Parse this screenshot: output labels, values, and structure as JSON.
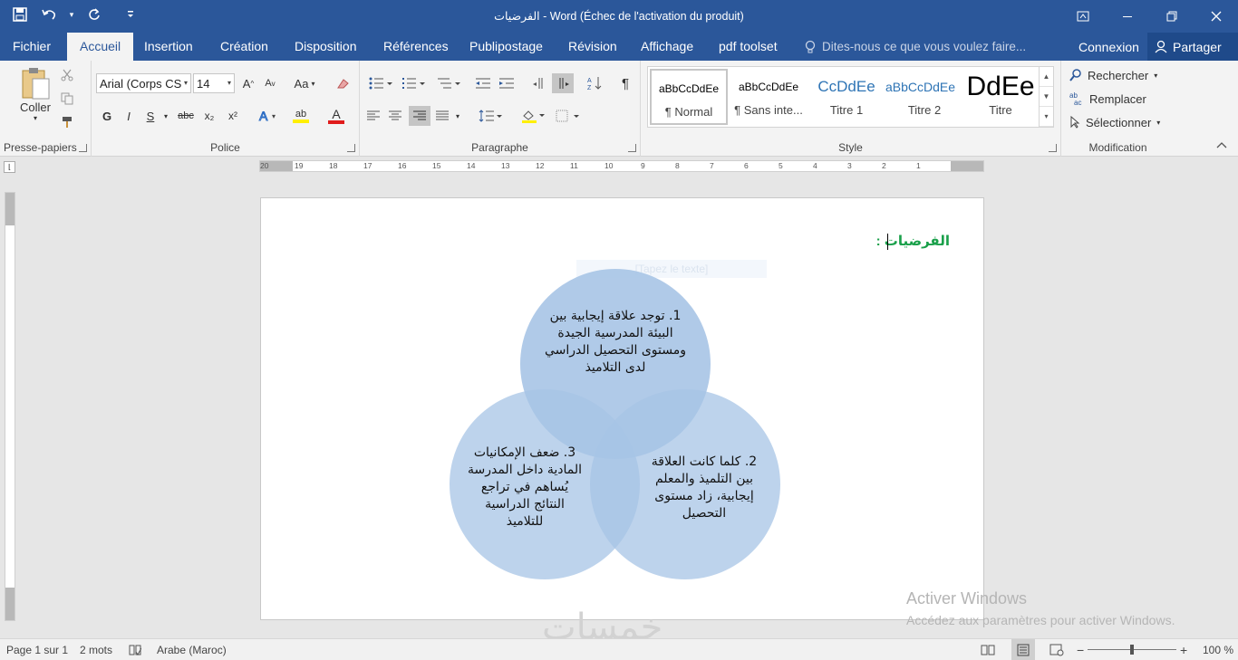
{
  "window": {
    "title": "الفرضيات - Word (Échec de l'activation du produit)"
  },
  "quick_access": {
    "save_icon": "save-icon",
    "undo_icon": "undo-icon",
    "redo_icon": "redo-icon",
    "customize_icon": "customize-icon"
  },
  "menu": {
    "tabs": [
      "Fichier",
      "Accueil",
      "Insertion",
      "Création",
      "Disposition",
      "Références",
      "Publipostage",
      "Révision",
      "Affichage",
      "pdf toolset"
    ],
    "active_tab": "Accueil",
    "tell_me_placeholder": "Dites-nous ce que vous voulez faire...",
    "connexion": "Connexion",
    "partager": "Partager"
  },
  "ribbon": {
    "clipboard": {
      "paste_label": "Coller",
      "group_label": "Presse-papiers"
    },
    "font": {
      "font_name": "Arial (Corps CS",
      "font_size": "14",
      "group_label": "Police",
      "bold": "G",
      "italic": "I",
      "underline": "S",
      "strike": "abc",
      "subscript": "x₂",
      "superscript": "x²",
      "grow": "A",
      "shrink": "A",
      "case": "Aa",
      "highlight": "ab",
      "fontcolor": "A"
    },
    "paragraph": {
      "group_label": "Paragraphe",
      "pilcrow": "¶"
    },
    "styles": {
      "group_label": "Style",
      "items": [
        {
          "preview": "aBbCcDdEe",
          "name": "¶ Normal"
        },
        {
          "preview": "aBbCcDdEe",
          "name": "¶ Sans inte..."
        },
        {
          "preview": "CcDdEe",
          "name": "Titre 1"
        },
        {
          "preview": "aBbCcDdEe",
          "name": "Titre 2"
        },
        {
          "preview": "DdEe",
          "name": "Titre"
        }
      ]
    },
    "editing": {
      "group_label": "Modification",
      "find": "Rechercher",
      "replace": "Remplacer",
      "select": "Sélectionner"
    }
  },
  "ruler": {
    "labels": [
      "20",
      "19",
      "18",
      "17",
      "16",
      "15",
      "14",
      "13",
      "12",
      "11",
      "10",
      "9",
      "8",
      "7",
      "6",
      "5",
      "4",
      "3",
      "2",
      "1"
    ]
  },
  "document": {
    "heading": "الفرضيات :",
    "smartart_placeholder": "[Tapez le texte]",
    "circles": [
      {
        "text": "1. توجد علاقة إيجابية بين البيئة المدرسية الجيدة ومستوى التحصيل الدراسي لدى التلاميذ"
      },
      {
        "text": "2. كلما كانت العلاقة بين التلميذ والمعلم إيجابية، زاد مستوى التحصيل"
      },
      {
        "text": "3. ضعف الإمكانيات المادية داخل المدرسة يُساهم في تراجع النتائج الدراسية للتلاميذ"
      }
    ],
    "colors": {
      "circle": "#a7c4e6",
      "overlap": "#7ea9d9",
      "heading": "#1aa04a"
    }
  },
  "watermark": {
    "activate_title": "Activer Windows",
    "activate_sub": "Accédez aux paramètres pour activer Windows.",
    "logo": "خمسات"
  },
  "status": {
    "page": "Page 1 sur 1",
    "words": "2 mots",
    "language": "Arabe (Maroc)",
    "zoom": "100 %"
  }
}
